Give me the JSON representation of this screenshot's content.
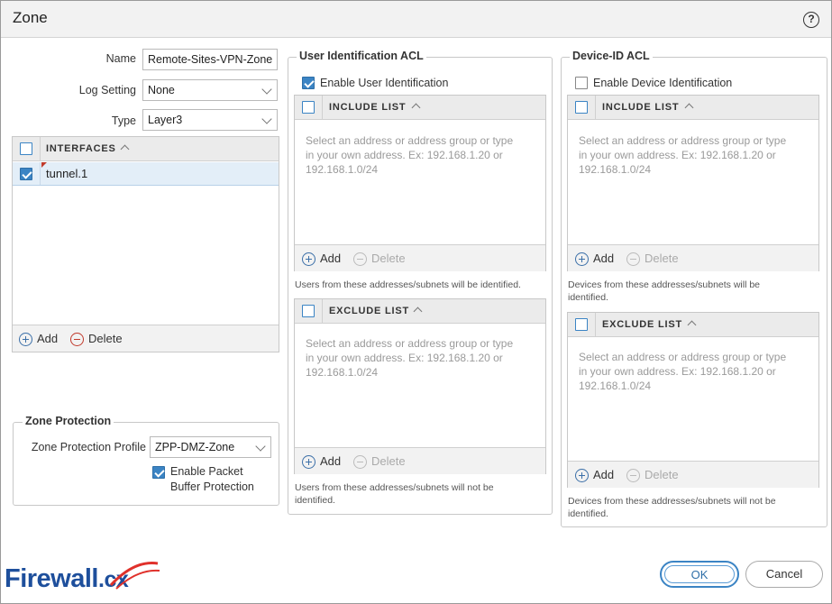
{
  "window": {
    "title": "Zone",
    "help": "?"
  },
  "general": {
    "name_label": "Name",
    "name_value": "Remote-Sites-VPN-Zone",
    "log_label": "Log Setting",
    "log_value": "None",
    "type_label": "Type",
    "type_value": "Layer3"
  },
  "interfaces": {
    "header": "INTERFACES",
    "rows": [
      {
        "name": "tunnel.1",
        "checked": true
      }
    ],
    "add": "Add",
    "delete": "Delete"
  },
  "zone_protection": {
    "legend": "Zone Protection",
    "profile_label": "Zone Protection Profile",
    "profile_value": "ZPP-DMZ-Zone",
    "buffer_label_1": "Enable Packet",
    "buffer_label_2": "Buffer Protection"
  },
  "user_acl": {
    "legend": "User Identification ACL",
    "enable_label": "Enable User Identification",
    "include": {
      "header": "INCLUDE LIST",
      "placeholder_1": "Select an address or address group or type",
      "placeholder_2": "in your own address. Ex: 192.168.1.20 or",
      "placeholder_3": "192.168.1.0/24",
      "add": "Add",
      "delete": "Delete",
      "note": "Users from these addresses/subnets will be identified."
    },
    "exclude": {
      "header": "EXCLUDE LIST",
      "placeholder_1": "Select an address or address group or type",
      "placeholder_2": "in your own address. Ex: 192.168.1.20 or",
      "placeholder_3": "192.168.1.0/24",
      "add": "Add",
      "delete": "Delete",
      "note_1": "Users from these addresses/subnets will not be",
      "note_2": "identified."
    }
  },
  "device_acl": {
    "legend": "Device-ID ACL",
    "enable_label": "Enable Device Identification",
    "include": {
      "header": "INCLUDE LIST",
      "placeholder_1": "Select an address or address group or type",
      "placeholder_2": "in your own address. Ex: 192.168.1.20 or",
      "placeholder_3": "192.168.1.0/24",
      "add": "Add",
      "delete": "Delete",
      "note_1": "Devices from these addresses/subnets will be",
      "note_2": "identified."
    },
    "exclude": {
      "header": "EXCLUDE LIST",
      "placeholder_1": "Select an address or address group or type",
      "placeholder_2": "in your own address. Ex: 192.168.1.20 or",
      "placeholder_3": "192.168.1.0/24",
      "add": "Add",
      "delete": "Delete",
      "note_1": "Devices from these addresses/subnets will not be",
      "note_2": "identified."
    }
  },
  "buttons": {
    "ok": "OK",
    "cancel": "Cancel"
  },
  "watermark": {
    "text": "Firewall",
    "suffix": ".cx"
  },
  "colors": {
    "accent": "#3b84c4",
    "brand": "#1e4f9c",
    "delete": "#c0392b"
  }
}
